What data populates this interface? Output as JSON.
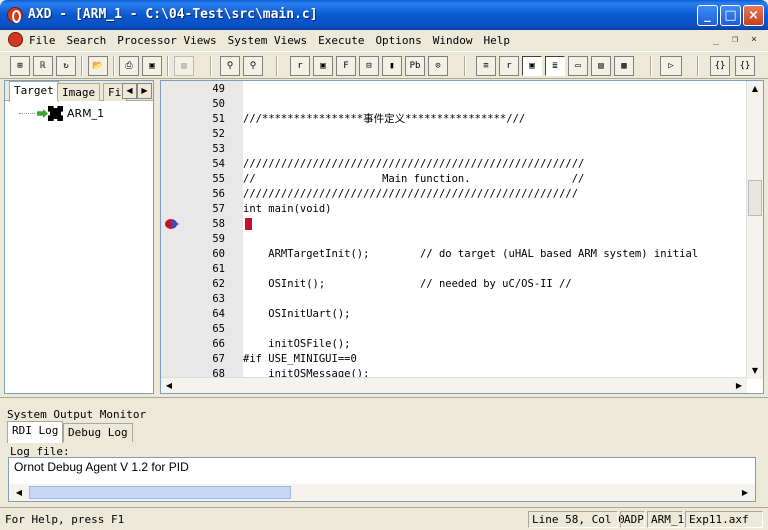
{
  "window": {
    "title": "AXD - [ARM_1 - C:\\04-Test\\src\\main.c]",
    "minimize": "_",
    "maximize": "□",
    "close": "×"
  },
  "menu": {
    "items": [
      "File",
      "Search",
      "Processor Views",
      "System Views",
      "Execute",
      "Options",
      "Window",
      "Help"
    ],
    "mdi": {
      "minimize": "_",
      "restore": "❐",
      "close": "×"
    }
  },
  "toolbar": {
    "groupA": [
      "⊞",
      "ℝ",
      "↻",
      "📂",
      "⎙",
      "▣",
      "▤",
      "⚲",
      "⚲"
    ],
    "groupB": [
      "r",
      "▣",
      "F",
      "⊟",
      "▮",
      "Pb",
      "⊙"
    ],
    "groupC": [
      "≡",
      "r",
      "▣",
      "≣",
      "▭",
      "▤",
      "▦"
    ],
    "groupD": [
      "▷",
      "{}",
      "{}"
    ]
  },
  "left_panel": {
    "tabs": [
      "Target",
      "Image",
      "Fi"
    ],
    "scroll_left": "◀",
    "scroll_right": "▶",
    "tree": [
      {
        "label": "ARM_1"
      }
    ]
  },
  "editor": {
    "lines": [
      {
        "n": "49",
        "text": ""
      },
      {
        "n": "50",
        "text": ""
      },
      {
        "n": "51",
        "text": "///****************事件定义****************///"
      },
      {
        "n": "52",
        "text": ""
      },
      {
        "n": "53",
        "text": ""
      },
      {
        "n": "54",
        "text": "//////////////////////////////////////////////////////"
      },
      {
        "n": "55",
        "text": "//                    Main function.                //"
      },
      {
        "n": "56",
        "text": "/////////////////////////////////////////////////////"
      },
      {
        "n": "57",
        "text": "int main(void)"
      },
      {
        "n": "58",
        "text": ""
      },
      {
        "n": "59",
        "text": ""
      },
      {
        "n": "60",
        "text": "    ARMTargetInit();        // do target (uHAL based ARM system) initial"
      },
      {
        "n": "61",
        "text": ""
      },
      {
        "n": "62",
        "text": "    OSInit();               // needed by uC/OS-II //"
      },
      {
        "n": "63",
        "text": ""
      },
      {
        "n": "64",
        "text": "    OSInitUart();"
      },
      {
        "n": "65",
        "text": ""
      },
      {
        "n": "66",
        "text": "    initOSFile();"
      },
      {
        "n": "67",
        "text": "#if USE_MINIGUI==0"
      },
      {
        "n": "68",
        "text": "    initOSMessage();"
      }
    ],
    "current_line": "58",
    "vscroll_position": 0.36
  },
  "output": {
    "title": "System Output Monitor",
    "tabs": [
      "RDI Log",
      "Debug Log"
    ],
    "log_label": "Log file:",
    "log_text": "Ornot Debug Agent V 1.2 for PID"
  },
  "status": {
    "help": "For Help, press F1",
    "position": "Line 58, Col 0",
    "mode": "ADP",
    "target": "ARM_1",
    "file": "Exp11.axf"
  }
}
